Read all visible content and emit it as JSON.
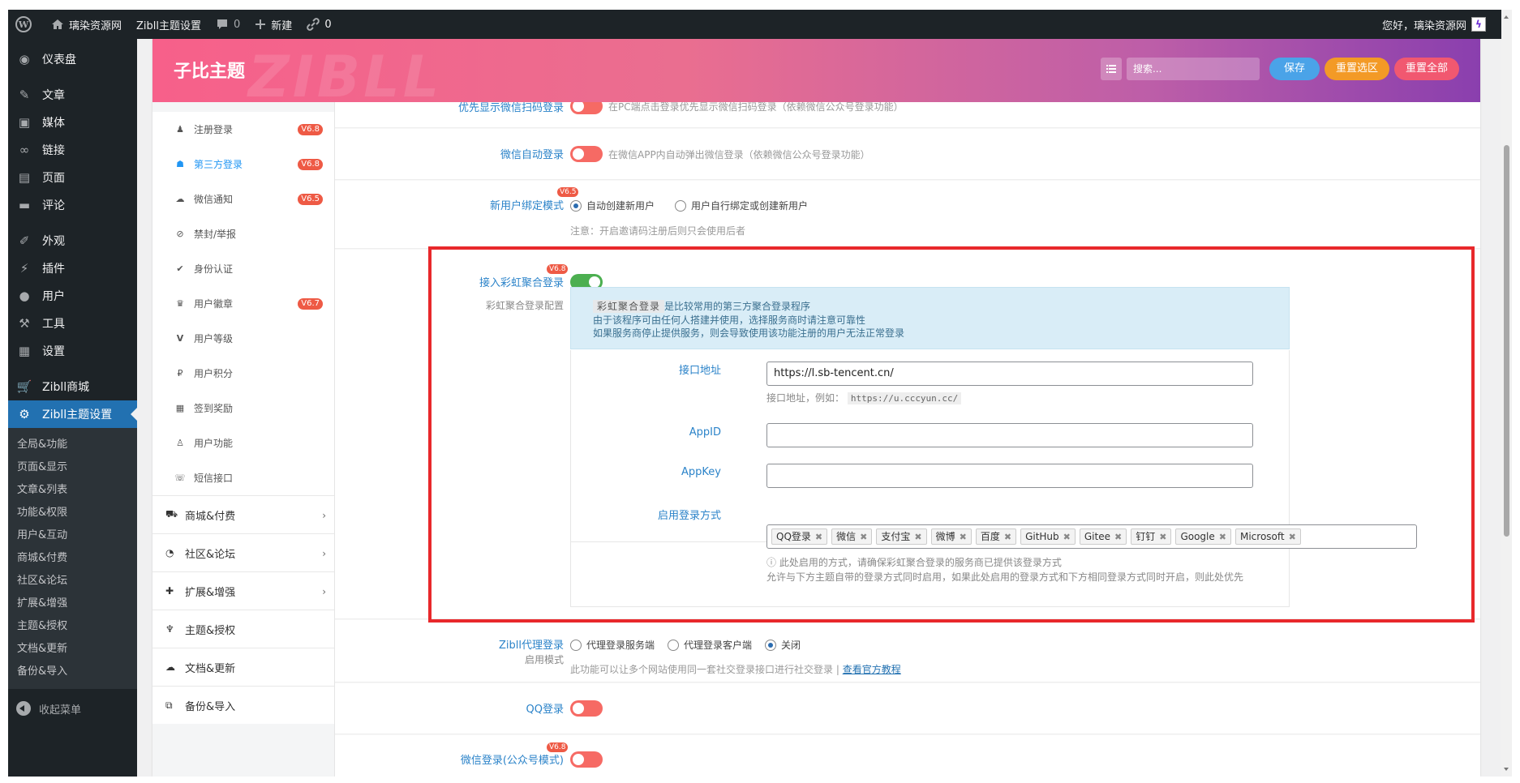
{
  "adminbar": {
    "site_name": "璃染资源网",
    "theme_settings": "Zibll主题设置",
    "comments_count": "0",
    "new_label": "新建",
    "links_count": "0",
    "greeting": "您好，璃染资源网"
  },
  "sidebar": {
    "items": [
      {
        "label": "仪表盘",
        "icon": "dashboard-icon"
      },
      {
        "label": "文章",
        "icon": "pin-icon"
      },
      {
        "label": "媒体",
        "icon": "media-icon"
      },
      {
        "label": "链接",
        "icon": "link-icon"
      },
      {
        "label": "页面",
        "icon": "page-icon"
      },
      {
        "label": "评论",
        "icon": "comment-icon"
      },
      {
        "label": "外观",
        "icon": "brush-icon"
      },
      {
        "label": "插件",
        "icon": "plugin-icon"
      },
      {
        "label": "用户",
        "icon": "user-icon"
      },
      {
        "label": "工具",
        "icon": "wrench-icon"
      },
      {
        "label": "设置",
        "icon": "settings-icon"
      },
      {
        "label": "Zibll商城",
        "icon": "cart-icon"
      },
      {
        "label": "Zibll主题设置",
        "icon": "gear-icon"
      }
    ],
    "submenu": [
      "全局&功能",
      "页面&显示",
      "文章&列表",
      "功能&权限",
      "用户&互动",
      "商城&付费",
      "社区&论坛",
      "扩展&增强",
      "主题&授权",
      "文档&更新",
      "备份&导入"
    ],
    "collapse_label": "收起菜单"
  },
  "header": {
    "title": "子比主题",
    "watermark": "ZIBLL",
    "search_placeholder": "搜索...",
    "save": "保存",
    "reset_section": "重置选区",
    "reset_all": "重置全部",
    "colors": {
      "save": "#4aa3e8",
      "reset_section": "#f39a26",
      "reset_all": "#f15870"
    }
  },
  "nav": {
    "sub_items": [
      {
        "label": "注册登录",
        "badge": "V6.8",
        "icon": "user-add-icon"
      },
      {
        "label": "第三方登录",
        "badge": "V6.8",
        "icon": "qq-icon",
        "active": true
      },
      {
        "label": "微信通知",
        "badge": "V6.5",
        "icon": "wechat-icon"
      },
      {
        "label": "禁封/举报",
        "badge": "",
        "icon": "ban-icon"
      },
      {
        "label": "身份认证",
        "badge": "",
        "icon": "check-circle-icon"
      },
      {
        "label": "用户徽章",
        "badge": "V6.7",
        "icon": "trophy-icon"
      },
      {
        "label": "用户等级",
        "badge": "",
        "icon": "level-icon"
      },
      {
        "label": "用户积分",
        "badge": "",
        "icon": "points-icon"
      },
      {
        "label": "签到奖励",
        "badge": "",
        "icon": "calendar-icon"
      },
      {
        "label": "用户功能",
        "badge": "",
        "icon": "user-outline-icon"
      },
      {
        "label": "短信接口",
        "badge": "",
        "icon": "sms-icon"
      }
    ],
    "main_items": [
      {
        "label": "商城&付费",
        "icon": "cart-icon",
        "arrow": "›"
      },
      {
        "label": "社区&论坛",
        "icon": "forum-icon",
        "arrow": "›"
      },
      {
        "label": "扩展&增强",
        "icon": "puzzle-icon",
        "arrow": "›"
      },
      {
        "label": "主题&授权",
        "icon": "license-icon",
        "arrow": ""
      },
      {
        "label": "文档&更新",
        "icon": "cloud-icon",
        "arrow": ""
      },
      {
        "label": "备份&导入",
        "icon": "backup-icon",
        "arrow": ""
      }
    ]
  },
  "fields": {
    "wechat_qr_first": {
      "label": "优先显示微信扫码登录",
      "desc": "在PC端点击登录优先显示微信扫码登录（依赖微信公众号登录功能）",
      "on": false
    },
    "wechat_auto": {
      "label": "微信自动登录",
      "desc": "在微信APP内自动弹出微信登录（依赖微信公众号登录功能）",
      "on": false
    },
    "bind_mode": {
      "label": "新用户绑定模式",
      "badge": "V6.5",
      "opt1": "自动创建新用户",
      "opt2": "用户自行绑定或创建新用户",
      "note": "注意：开启邀请码注册后则只会使用后者",
      "selected": 1
    },
    "rainbow": {
      "label": "接入彩虹聚合登录",
      "badge": "V6.8",
      "on": true,
      "config_label": "彩虹聚合登录配置",
      "info_hl": "彩虹聚合登录",
      "info1": "是比较常用的第三方聚合登录程序",
      "info2": "由于该程序可由任何人搭建并使用，选择服务商时请注意可靠性",
      "info3": "如果服务商停止提供服务，则会导致使用该功能注册的用户无法正常登录",
      "api_label": "接口地址",
      "api_value": "https://l.sb-tencent.cn/",
      "api_hint": "接口地址，例如：",
      "api_example": "https://u.cccyun.cc/",
      "appid_label": "AppID",
      "appid_value": "",
      "appkey_label": "AppKey",
      "appkey_value": "",
      "methods_label": "启用登录方式",
      "methods": [
        "QQ登录",
        "微信",
        "支付宝",
        "微博",
        "百度",
        "GitHub",
        "Gitee",
        "钉钉",
        "Google",
        "Microsoft"
      ],
      "methods_hint1": "此处启用的方式，请确保彩虹聚合登录的服务商已提供该登录方式",
      "methods_hint2": "允许与下方主题自带的登录方式同时启用，如果此处启用的登录方式和下方相同登录方式同时开启，则此处优先"
    },
    "proxy": {
      "label": "Zibll代理登录",
      "sublabel": "启用模式",
      "opt1": "代理登录服务端",
      "opt2": "代理登录客户端",
      "opt3": "关闭",
      "selected": 3,
      "desc": "此功能可以让多个网站使用同一套社交登录接口进行社交登录 |",
      "link": "查看官方教程"
    },
    "qq": {
      "label": "QQ登录",
      "on": false
    },
    "wechat_mp": {
      "label": "微信登录(公众号模式)",
      "badge": "V6.8",
      "on": false
    }
  }
}
